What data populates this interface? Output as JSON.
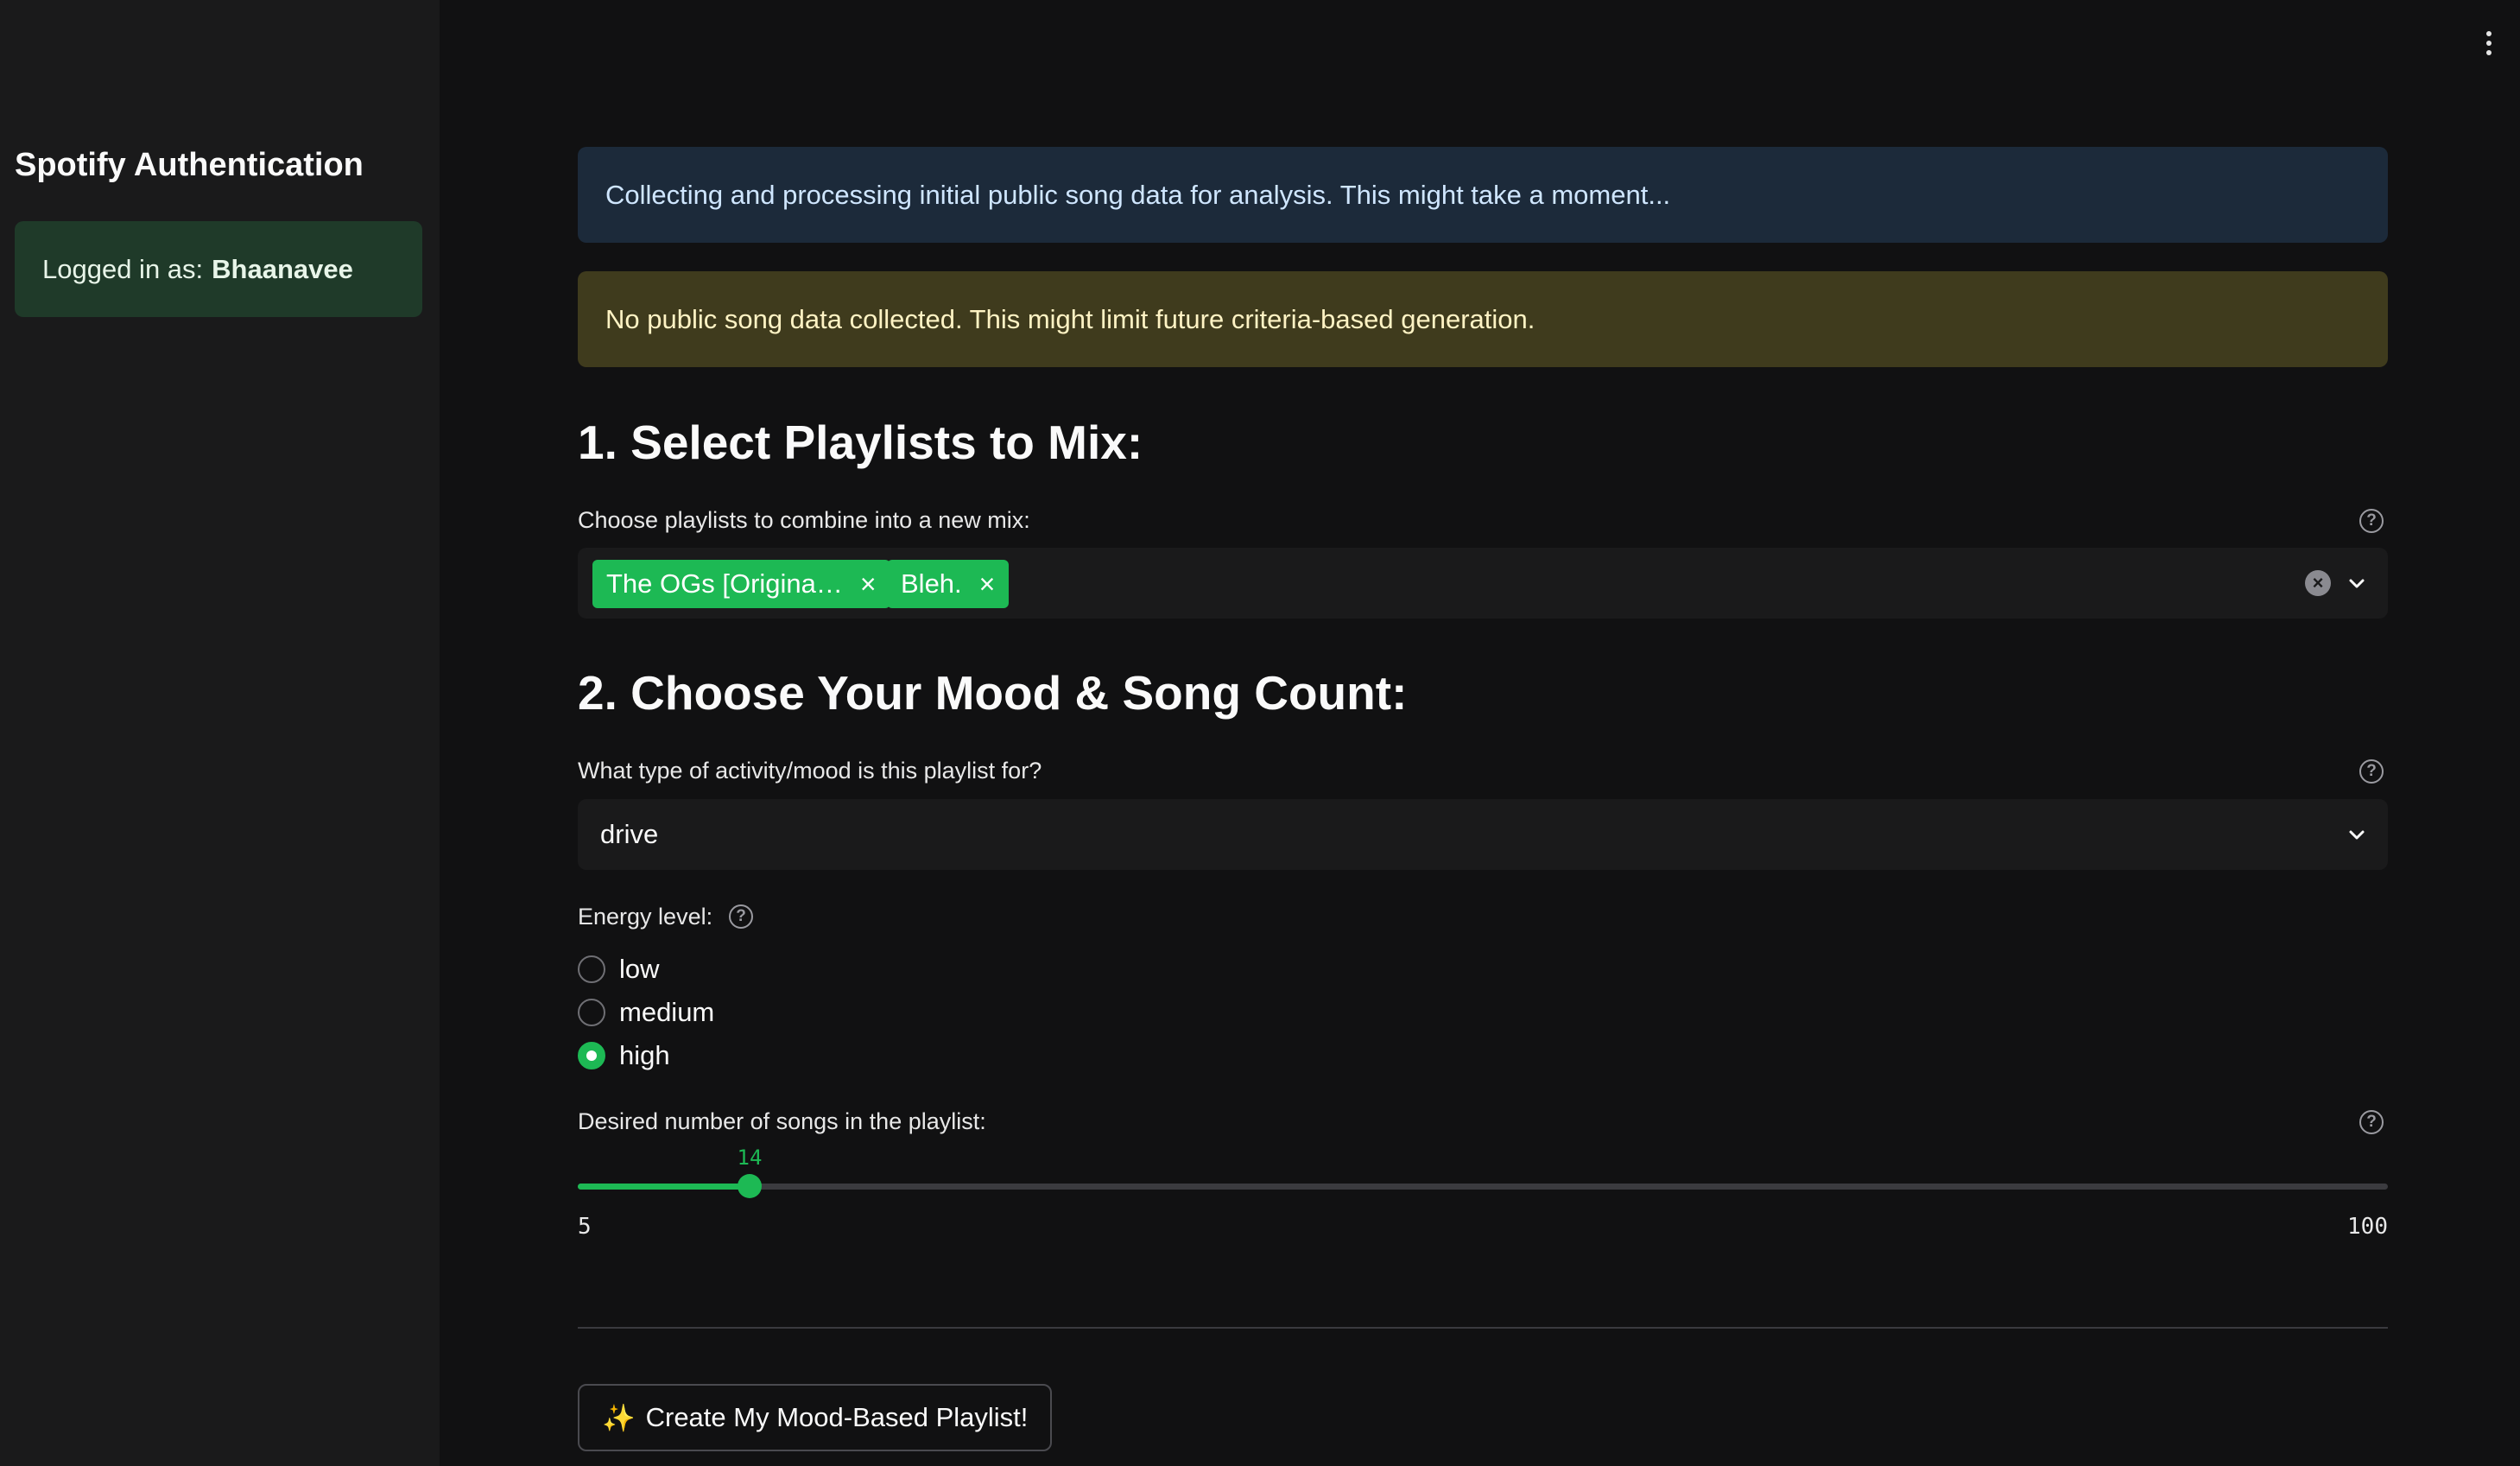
{
  "sidebar": {
    "title": "Spotify Authentication",
    "login_prefix": "Logged in as:",
    "username": "Bhaanavee"
  },
  "alerts": {
    "info": "Collecting and processing initial public song data for analysis. This might take a moment...",
    "warning": "No public song data collected. This might limit future criteria-based generation."
  },
  "section1": {
    "heading": "1. Select Playlists to Mix:",
    "label": "Choose playlists to combine into a new mix:",
    "chips": [
      "The OGs [Origina…",
      "Bleh."
    ]
  },
  "section2": {
    "heading": "2. Choose Your Mood & Song Count:",
    "mood_label": "What type of activity/mood is this playlist for?",
    "mood_value": "drive",
    "energy_label": "Energy level:",
    "energy_options": [
      "low",
      "medium",
      "high"
    ],
    "energy_selected": "high",
    "songs_label": "Desired number of songs in the playlist:",
    "songs_value": 14,
    "songs_min": 5,
    "songs_max": 100
  },
  "create_button": {
    "icon": "✨",
    "label": "Create My Mood-Based Playlist!"
  },
  "icons": {
    "help": "?",
    "chip_remove": "×",
    "clear_all": "×"
  },
  "colors": {
    "accent": "#1db954",
    "background": "#111112",
    "sidebar": "#1a1a1b",
    "info_bg": "#1c2a3a",
    "warning_bg": "#3f3b1d",
    "success_bg": "#1f3a29"
  }
}
